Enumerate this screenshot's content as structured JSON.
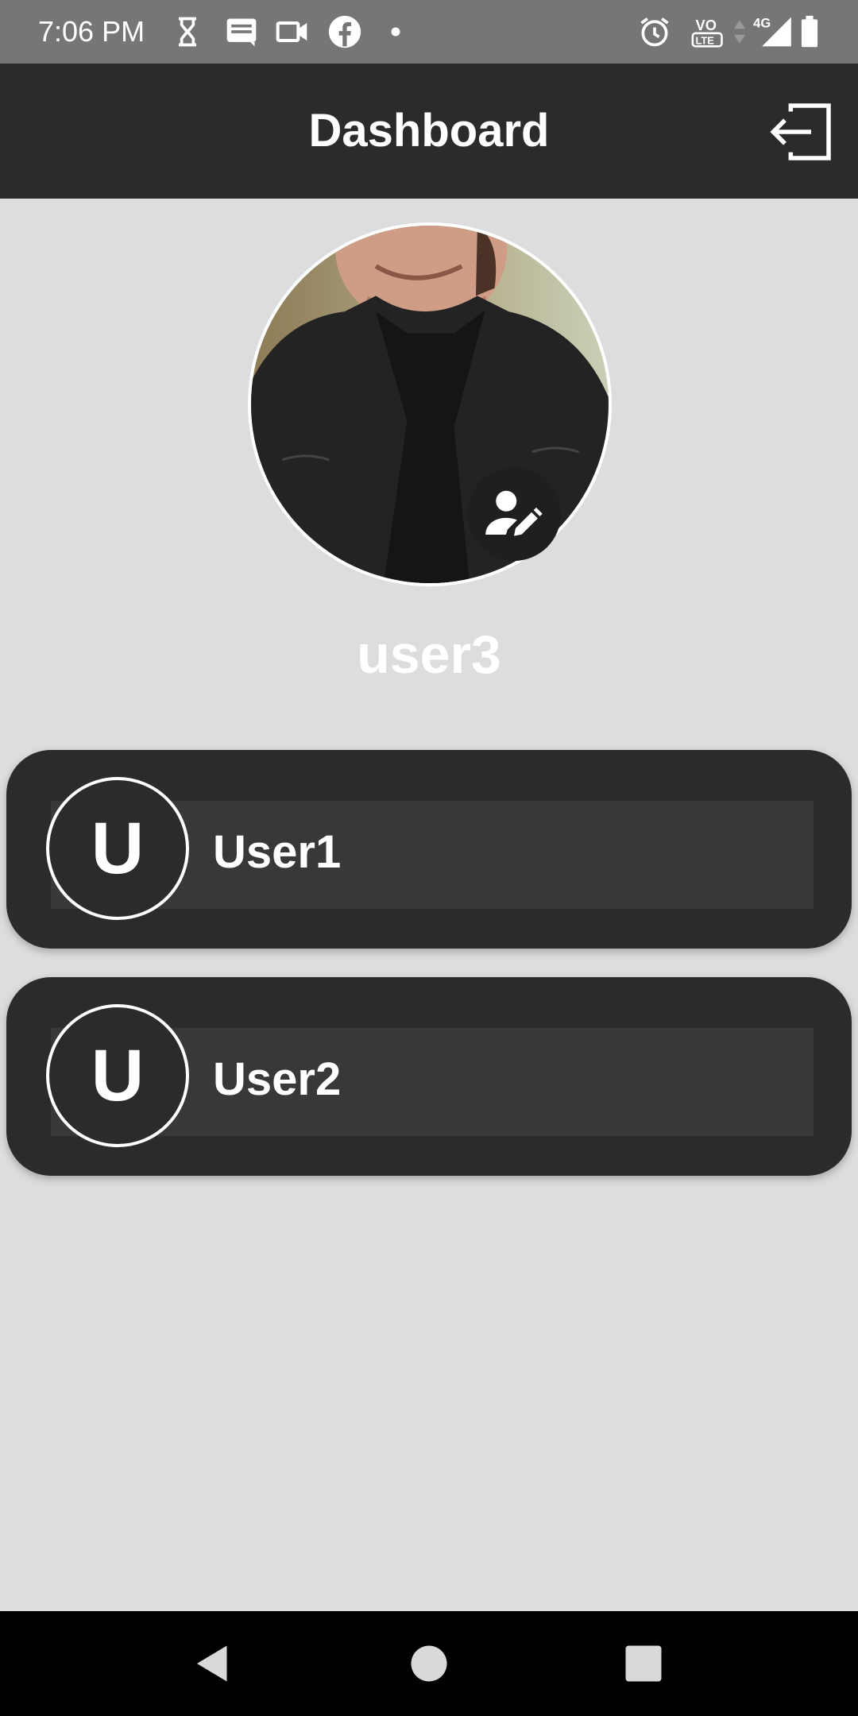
{
  "status_bar": {
    "time": "7:06 PM",
    "left_icons": [
      "hourglass-icon",
      "message-icon",
      "video-icon",
      "facebook-icon",
      "notification-dot-icon"
    ],
    "right_icons": [
      "alarm-icon",
      "volte-icon",
      "data-arrows-icon",
      "signal-icon",
      "battery-icon"
    ],
    "volte_label": "VO",
    "lte_label": "LTE",
    "network_label": "4G"
  },
  "app_bar": {
    "title": "Dashboard",
    "logout_icon": "logout-icon"
  },
  "profile": {
    "username": "user3",
    "edit_icon": "edit-profile-icon"
  },
  "users": [
    {
      "initial": "U",
      "name": "User1"
    },
    {
      "initial": "U",
      "name": "User2"
    }
  ],
  "nav_bar": {
    "icons": [
      "back-icon",
      "home-icon",
      "recents-icon"
    ]
  },
  "colors": {
    "background": "#dcdddf",
    "app_bar": "#2b2b2b",
    "status_bar": "#767676",
    "card": "#2b2b2b",
    "card_inner": "#373838",
    "text": "#ffffff"
  }
}
